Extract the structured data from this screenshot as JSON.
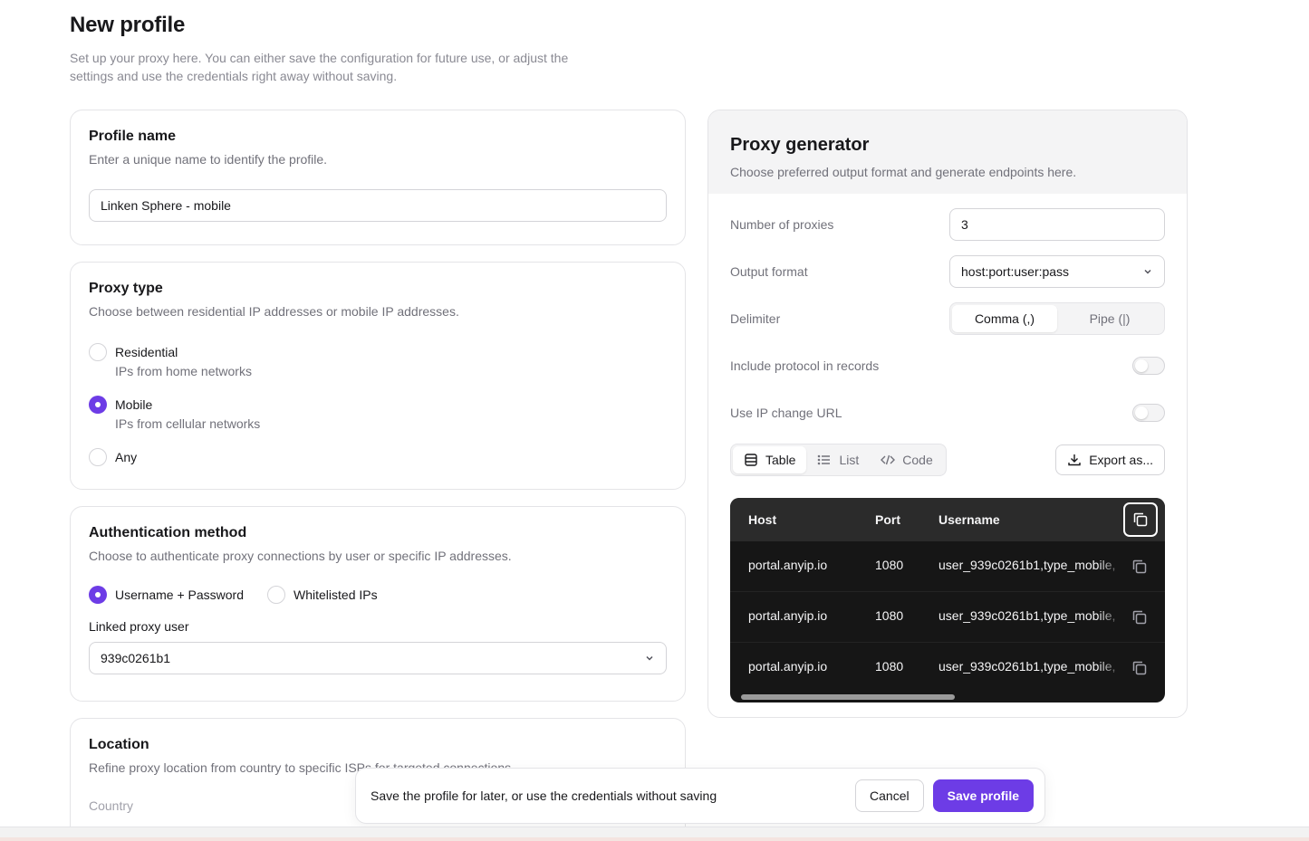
{
  "page": {
    "title": "New profile",
    "subtitle_line1": "Set up your proxy here. You can either save the configuration for future use, or adjust the",
    "subtitle_line2": "settings and use the credentials right away without saving."
  },
  "profile_name": {
    "title": "Profile name",
    "description": "Enter a unique name to identify the profile.",
    "value": "Linken Sphere - mobile"
  },
  "proxy_type": {
    "title": "Proxy type",
    "description": "Choose between residential IP addresses or mobile IP addresses.",
    "options": [
      {
        "label": "Residential",
        "sub": "IPs from home networks",
        "checked": false
      },
      {
        "label": "Mobile",
        "sub": "IPs from cellular networks",
        "checked": true
      },
      {
        "label": "Any",
        "sub": "",
        "checked": false
      }
    ]
  },
  "auth": {
    "title": "Authentication method",
    "description": "Choose to authenticate proxy connections by user or specific IP addresses.",
    "option_userpass": "Username + Password",
    "option_whitelist": "Whitelisted IPs",
    "selected": "Username + Password",
    "linked_user_label": "Linked proxy user",
    "linked_user_value": "939c0261b1"
  },
  "location": {
    "title": "Location",
    "description": "Refine proxy location from country to specific ISPs for targeted connections",
    "country_label": "Country"
  },
  "generator": {
    "title": "Proxy generator",
    "description": "Choose preferred output format and generate endpoints here.",
    "num_label": "Number of proxies",
    "num_value": "3",
    "format_label": "Output format",
    "format_value": "host:port:user:pass",
    "delimiter_label": "Delimiter",
    "delimiter_comma": "Comma (,)",
    "delimiter_pipe": "Pipe (|)",
    "delimiter_selected": "Comma (,)",
    "protocol_label": "Include protocol in records",
    "protocol_on": false,
    "ipchange_label": "Use IP change URL",
    "ipchange_on": false,
    "view_table": "Table",
    "view_list": "List",
    "view_code": "Code",
    "view_selected": "Table",
    "export_label": "Export as...",
    "columns": {
      "host": "Host",
      "port": "Port",
      "username": "Username"
    },
    "rows": [
      {
        "host": "portal.anyip.io",
        "port": "1080",
        "username": "user_939c0261b1,type_mobile,"
      },
      {
        "host": "portal.anyip.io",
        "port": "1080",
        "username": "user_939c0261b1,type_mobile,"
      },
      {
        "host": "portal.anyip.io",
        "port": "1080",
        "username": "user_939c0261b1,type_mobile,"
      }
    ]
  },
  "save_bar": {
    "text": "Save the profile for later, or use the credentials without saving",
    "cancel": "Cancel",
    "save": "Save profile"
  },
  "colors": {
    "accent": "#6d3ce6",
    "table_bg": "#161616",
    "table_head_bg": "#2b2b2b"
  }
}
